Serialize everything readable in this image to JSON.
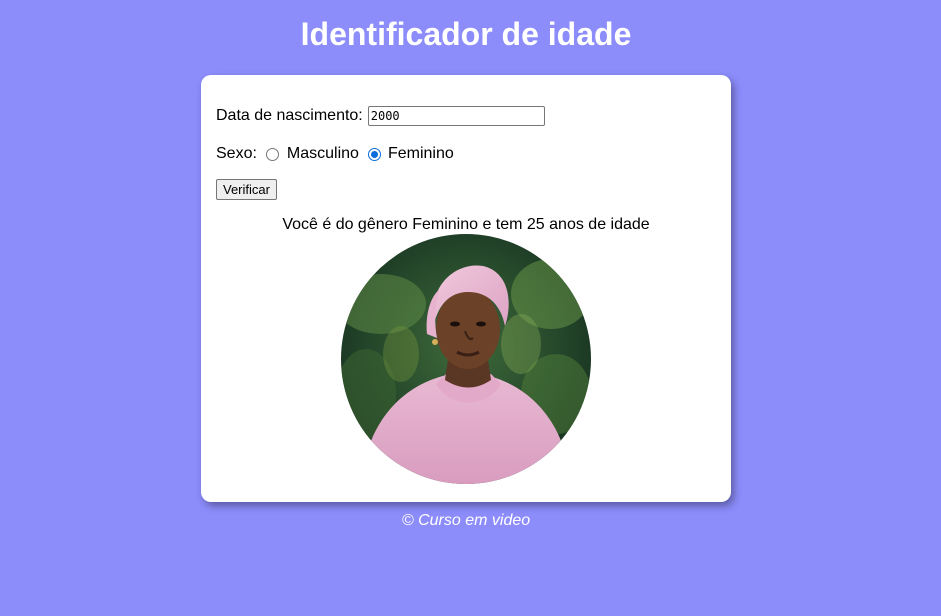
{
  "header": {
    "title": "Identificador de idade"
  },
  "form": {
    "birth_label": "Data de nascimento:",
    "birth_value": "2000",
    "sex_label": "Sexo:",
    "options": [
      {
        "label": "Masculino",
        "checked": false
      },
      {
        "label": "Feminino",
        "checked": true
      }
    ],
    "button_label": "Verificar"
  },
  "result": {
    "text": "Você é do gênero Feminino e tem 25 anos de idade",
    "image": "woman-portrait"
  },
  "footer": {
    "text": "© Curso em video"
  },
  "colors": {
    "background": "#8c8cfb",
    "card": "#ffffff",
    "radio_accent": "#0b6ddc"
  }
}
